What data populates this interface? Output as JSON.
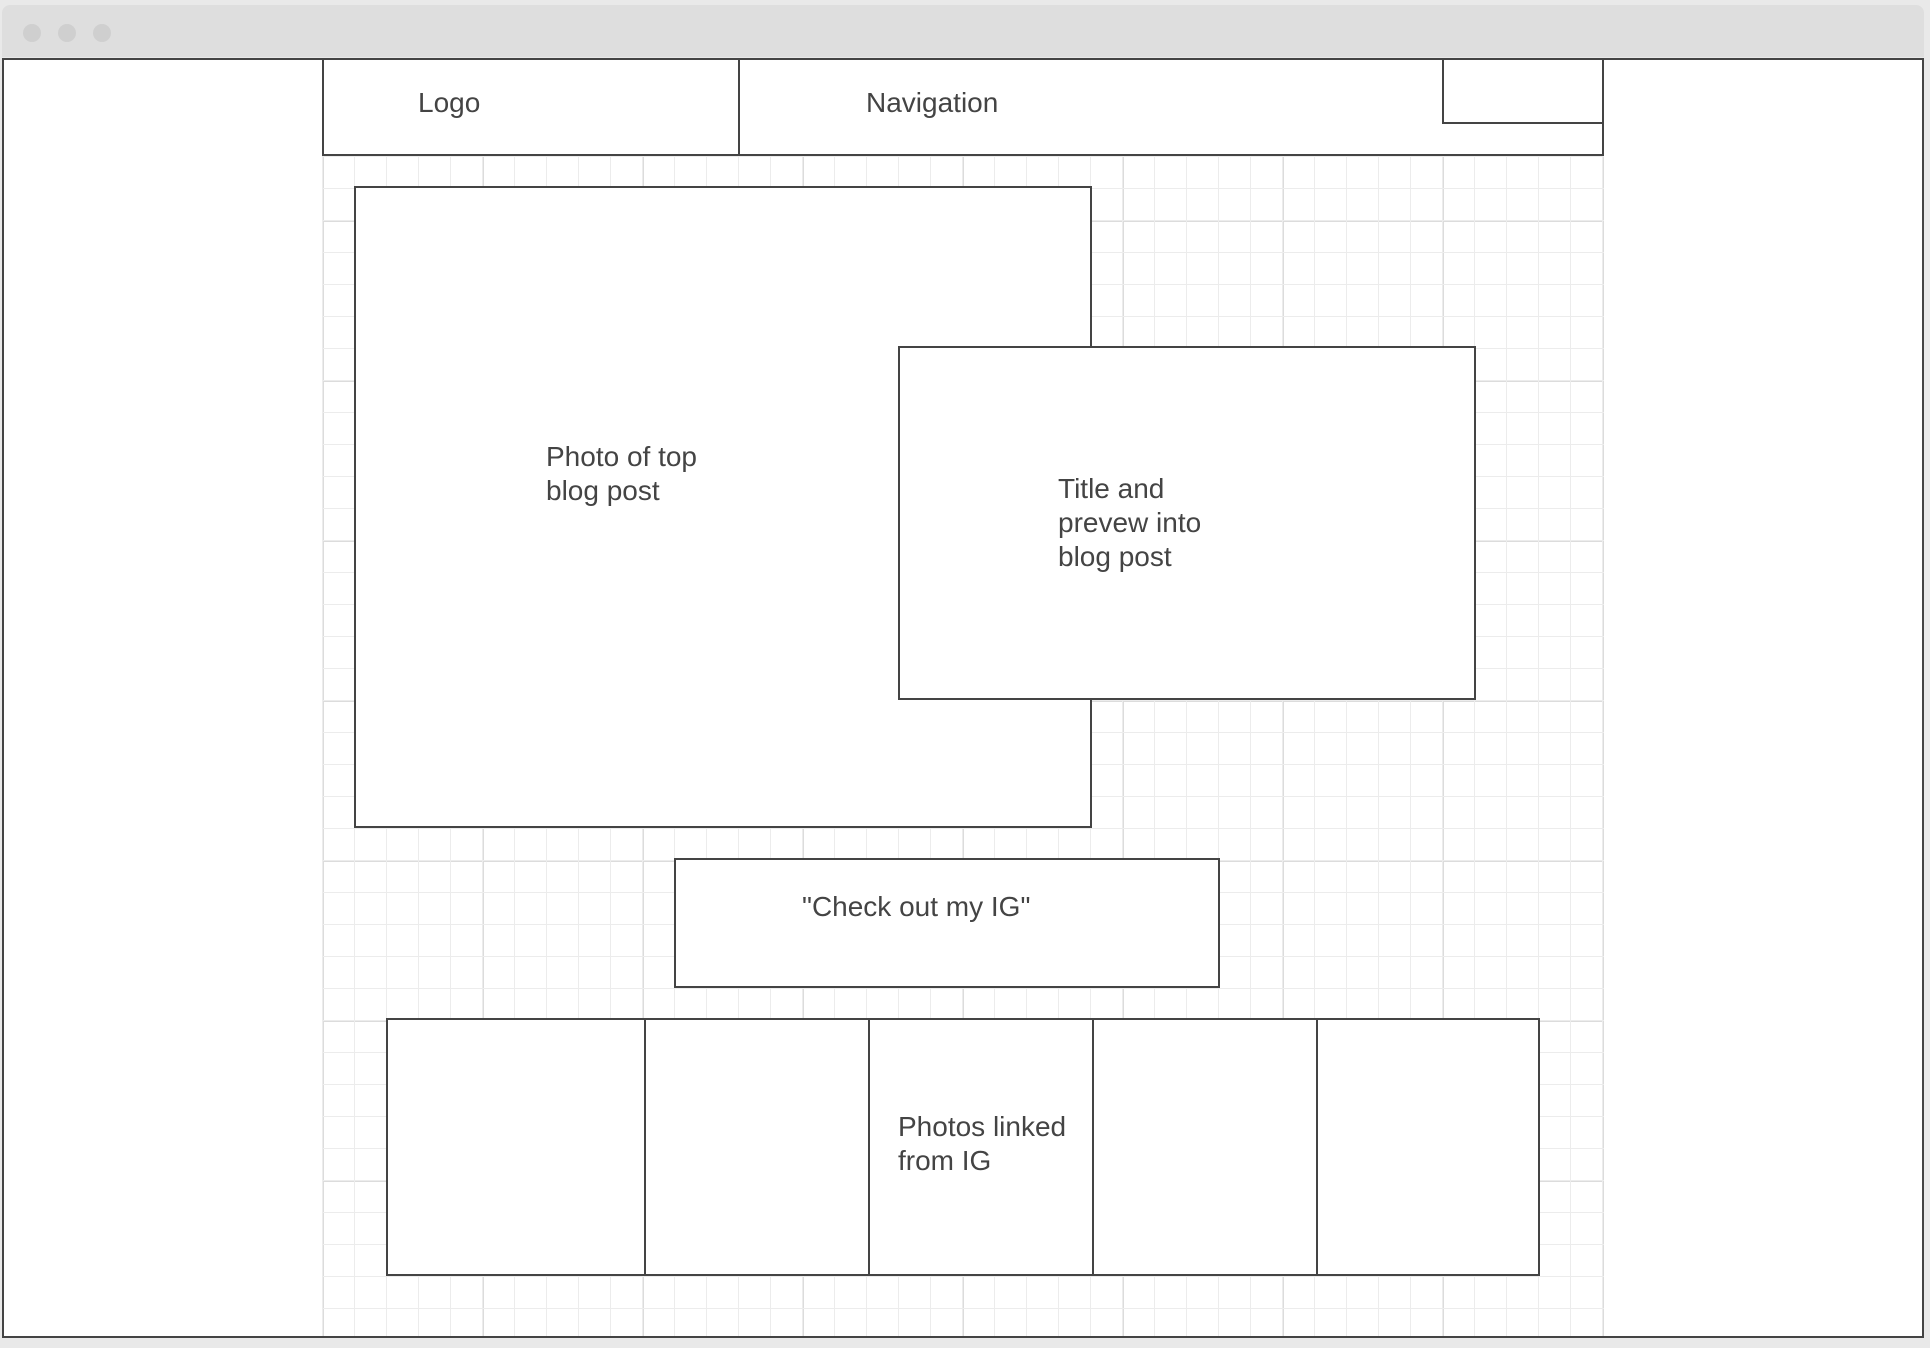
{
  "header": {
    "logo_label": "Logo",
    "nav_label": "Navigation"
  },
  "main": {
    "photo_label": "Photo of top\nblog post",
    "title_preview_label": "Title and\nprevew into\nblog post",
    "ig_cta_label": "\"Check out my IG\"",
    "ig_photos_label": "Photos linked\nfrom IG",
    "ig_photo_count": 5
  }
}
